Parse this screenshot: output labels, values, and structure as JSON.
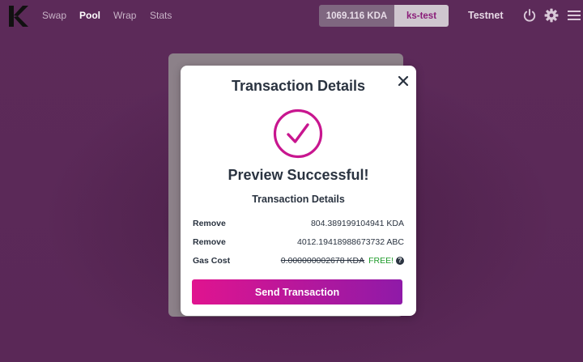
{
  "nav": {
    "items": [
      {
        "label": "Swap",
        "active": false
      },
      {
        "label": "Pool",
        "active": true
      },
      {
        "label": "Wrap",
        "active": false
      },
      {
        "label": "Stats",
        "active": false
      }
    ]
  },
  "wallet": {
    "balance": "1069.116 KDA",
    "account": "ks-test",
    "network": "Testnet"
  },
  "modal": {
    "title": "Transaction Details",
    "status": "Preview Successful!",
    "subtitle": "Transaction Details",
    "rows": [
      {
        "label": "Remove",
        "value": "804.389199104941 KDA"
      },
      {
        "label": "Remove",
        "value": "4012.19418988673732 ABC"
      },
      {
        "label": "Gas Cost",
        "value": "0.000000002678 KDA",
        "free": "FREE!",
        "help": "?"
      }
    ],
    "action_label": "Send Transaction"
  },
  "colors": {
    "background": "#5e2a5c",
    "accent_start": "#e0148f",
    "accent_end": "#8f1aa8",
    "success_circle": "#c8168f",
    "free_text": "#1e9a2a"
  },
  "icons": [
    "logo-icon",
    "power-icon",
    "gear-icon",
    "menu-icon",
    "close-icon",
    "checkmark-icon",
    "help-icon"
  ]
}
